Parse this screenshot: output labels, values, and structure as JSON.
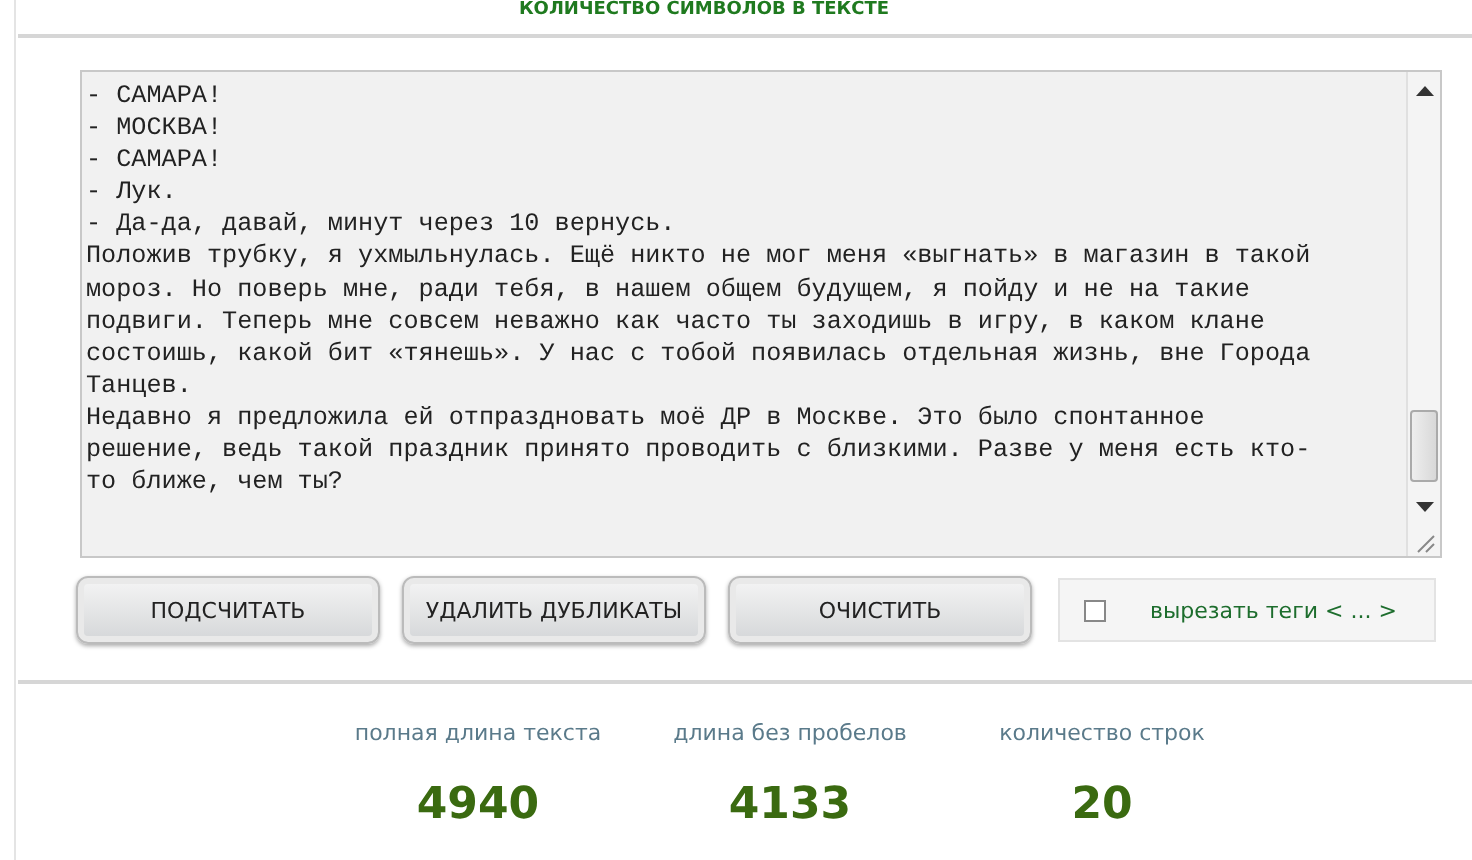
{
  "title": "КОЛИЧЕСТВО СИМВОЛОВ В ТЕКСТЕ",
  "text_area": {
    "lines": [
      "- САМАРА!",
      "- МОСКВА!",
      "- САМАРА!",
      "- Лук.",
      "- Да-да, давай, минут через 10 вернусь.",
      "Положив трубку, я ухмыльнулась. Ещё никто не мог меня «выгнать» в магазин в такой",
      "мороз. Но поверь мне, ради тебя, в нашем общем будущем, я пойду и не на такие",
      "подвиги. Теперь мне совсем неважно как часто ты заходишь в игру, в каком клане",
      "состоишь, какой бит «тянешь». У нас с тобой появилась отдельная жизнь, вне Города",
      "Танцев.",
      "Недавно я предложила ей отпраздновать моё ДР в Москве. Это было спонтанное",
      "решение, ведь такой праздник принято проводить с близкими. Разве у меня есть кто-",
      "то ближе, чем ты?"
    ]
  },
  "buttons": [
    "ПОДСЧИТАТЬ",
    "УДАЛИТЬ ДУБЛИКАТЫ",
    "ОЧИСТИТЬ"
  ],
  "strip_tags": {
    "label": "вырезать теги < ... >",
    "checked": false
  },
  "stats": [
    {
      "label": "полная длина текста",
      "value": "4940"
    },
    {
      "label": "длина без пробелов",
      "value": "4133"
    },
    {
      "label": "количество строк",
      "value": "20"
    }
  ]
}
